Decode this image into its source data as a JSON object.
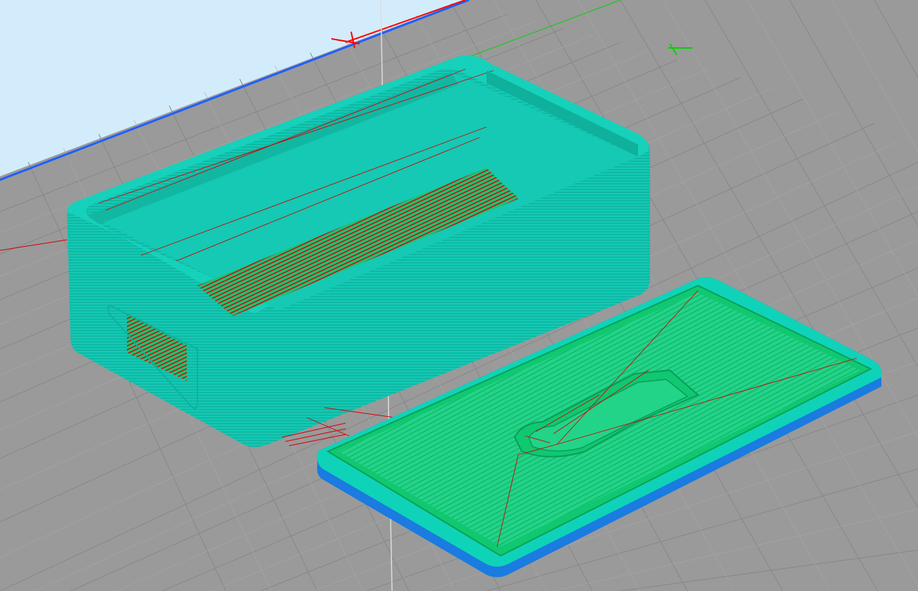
{
  "app": {
    "view": "3d-slice-preview"
  },
  "colors": {
    "sky": "#d3ecfb",
    "bed": "#999999",
    "grid_minor": "#a9a9a9",
    "grid_major": "#8a8a8a",
    "x_axis": "#ff0000",
    "y_axis": "#00d200",
    "bed_edge": "#1f5fff",
    "perimeter_outer": "#00c8b0",
    "perimeter_inner": "#10d070",
    "infill": "#18c87a",
    "travel": "#d40000",
    "support": "#1a7be0"
  },
  "scene": {
    "objects": [
      {
        "name": "box-body",
        "feature": "walls"
      },
      {
        "name": "box-lid",
        "feature": "plate"
      }
    ]
  }
}
